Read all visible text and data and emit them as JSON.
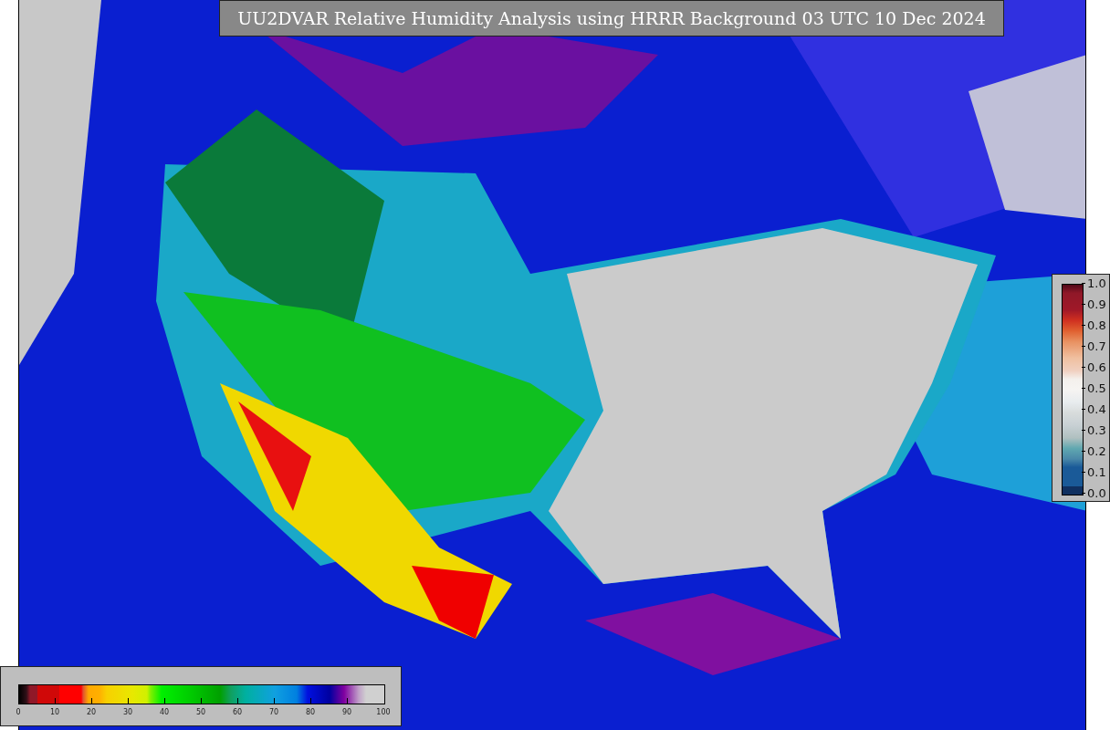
{
  "title": "UU2DVAR Relative Humidity Analysis using HRRR Background 03 UTC 10 Dec 2024",
  "humidity_colorbar": {
    "ticks": [
      "0",
      "10",
      "20",
      "30",
      "40",
      "50",
      "60",
      "70",
      "80",
      "90",
      "100"
    ]
  },
  "ratio_colorbar": {
    "ticks": [
      "1.0",
      "0.9",
      "0.8",
      "0.7",
      "0.6",
      "0.5",
      "0.4",
      "0.3",
      "0.2",
      "0.1",
      "0.0"
    ]
  }
}
